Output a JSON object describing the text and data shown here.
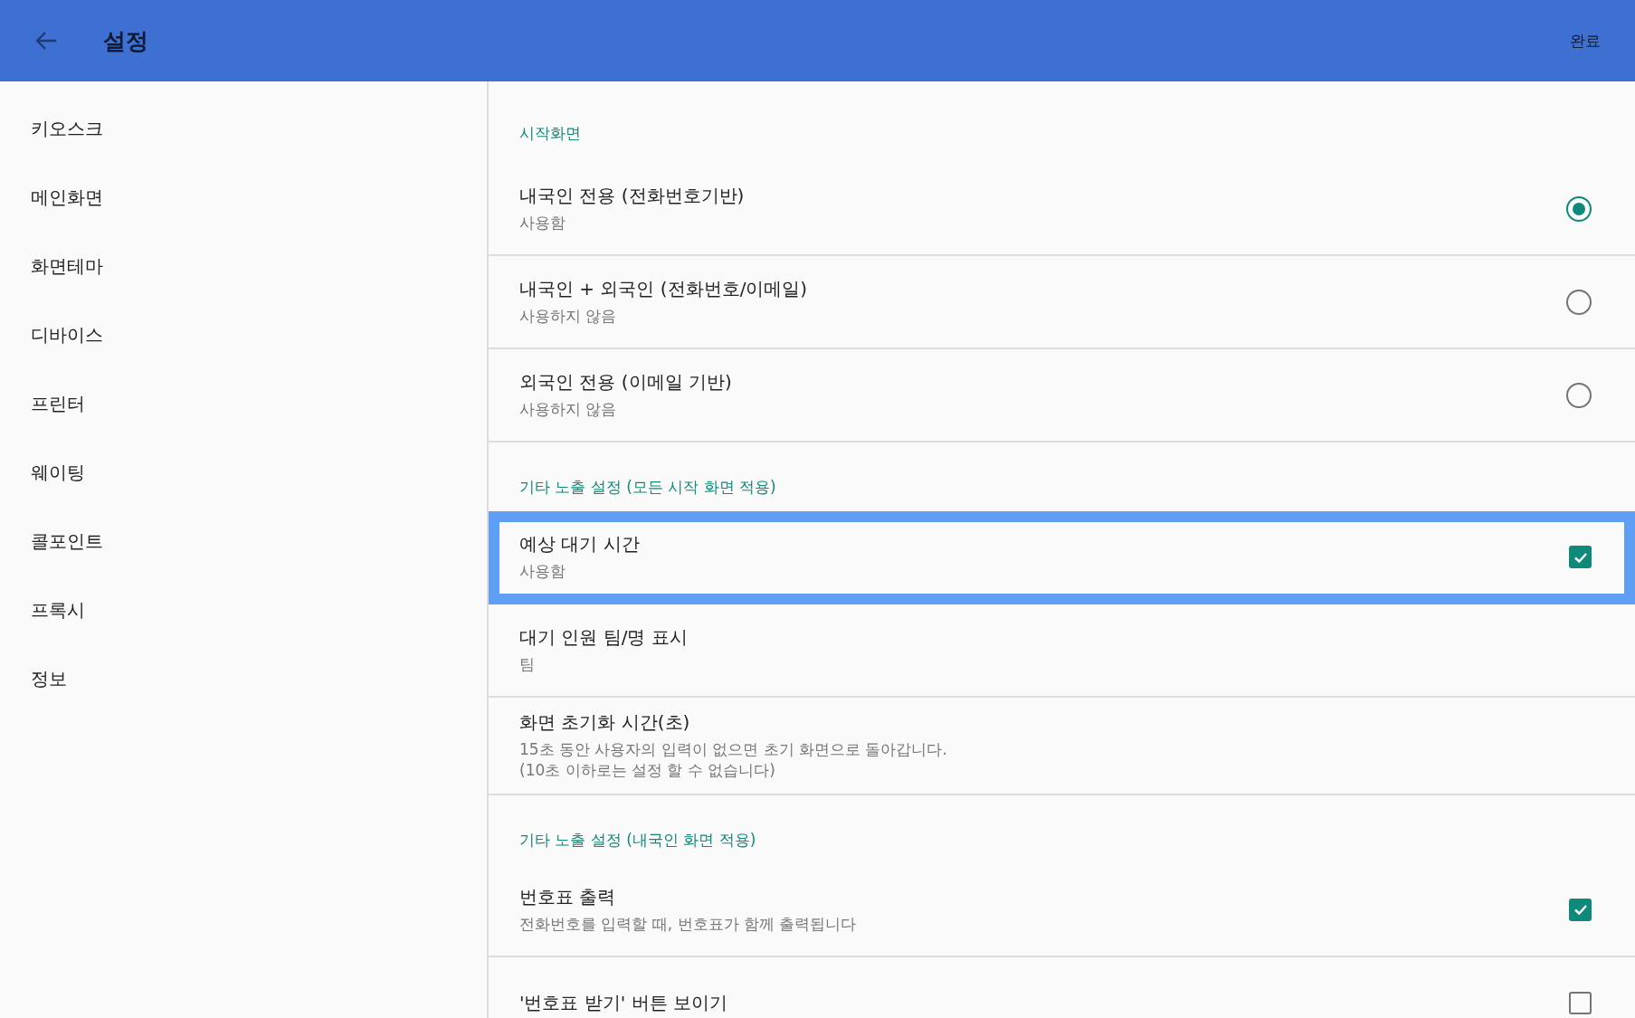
{
  "app_bar": {
    "title": "설정",
    "action": "완료"
  },
  "sidebar": {
    "items": [
      "키오스크",
      "메인화면",
      "화면테마",
      "디바이스",
      "프린터",
      "웨이팅",
      "콜포인트",
      "프록시",
      "정보"
    ]
  },
  "sections": [
    {
      "title": "시작화면",
      "items": [
        {
          "kind": "radio",
          "title": "내국인 전용 (전화번호기반)",
          "subtitle": "사용함",
          "selected": true,
          "focused": false
        },
        {
          "kind": "radio",
          "title": "내국인 + 외국인 (전화번호/이메일)",
          "subtitle": "사용하지 않음",
          "selected": false,
          "focused": false
        },
        {
          "kind": "radio",
          "title": "외국인 전용 (이메일 기반)",
          "subtitle": "사용하지 않음",
          "selected": false,
          "focused": false
        }
      ]
    },
    {
      "title": "기타 노출 설정 (모든 시작 화면 적용)",
      "items": [
        {
          "kind": "checkbox",
          "title": "예상 대기 시간",
          "subtitle": "사용함",
          "checked": true,
          "focused": true
        },
        {
          "kind": "text",
          "title": "대기 인원 팀/명 표시",
          "subtitle": "팀",
          "focused": false
        },
        {
          "kind": "text",
          "title": "화면 초기화 시간(초)",
          "subtitle": "15초 동안 사용자의 입력이 없으면 초기 화면으로 돌아갑니다.\n(10초 이하로는 설정 할 수 없습니다)",
          "focused": false
        }
      ]
    },
    {
      "title": "기타 노출 설정 (내국인 화면 적용)",
      "items": [
        {
          "kind": "checkbox",
          "title": "번호표 출력",
          "subtitle": "전화번호를 입력할 때, 번호표가 함께 출력됩니다",
          "checked": true,
          "focused": false
        },
        {
          "kind": "checkbox",
          "title": "'번호표 받기' 버튼 보이기",
          "checked": false,
          "focused": false
        }
      ]
    }
  ]
}
